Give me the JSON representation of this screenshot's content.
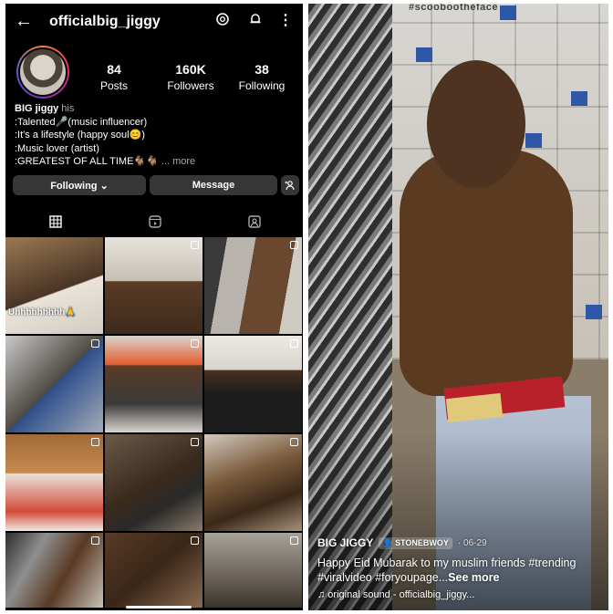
{
  "profile": {
    "username": "officialbig_jiggy",
    "posts": "84",
    "posts_label": "Posts",
    "followers": "160K",
    "followers_label": "Followers",
    "following": "38",
    "following_label": "Following",
    "display_name": "BIG jiggy",
    "pronouns": "his",
    "bio_lines": [
      ":Talented🎤(music influencer)",
      ":It's a lifestyle (happy soul😊)",
      ":Music lover (artist)",
      ":GREATEST OF ALL TIME🐐🐐"
    ],
    "more": "... more",
    "following_button": "Following ⌄",
    "message_button": "Message"
  },
  "grid": {
    "captions": [
      "Uhhhhhhhhh🙏",
      "",
      "",
      "",
      "",
      "",
      "",
      "",
      "",
      "",
      "",
      ""
    ]
  },
  "video": {
    "top_text": "#scoobootheface",
    "author": "BIG JIGGY",
    "collab": "STONEBWOY",
    "date": "· 06-29",
    "caption": "Happy Eid Mubarak to my muslim friends #trending #viralvideo #foryoupage...",
    "see_more": "See more",
    "sound": "♫ original sound - officialbig_jiggy..."
  },
  "icons": {
    "back": "back-arrow-icon",
    "threads": "threads-icon",
    "notifications": "bell-icon",
    "menu": "kebab-menu-icon",
    "add_user": "add-user-icon",
    "grid": "grid-icon",
    "reels": "reels-icon",
    "tagged": "tagged-icon"
  }
}
